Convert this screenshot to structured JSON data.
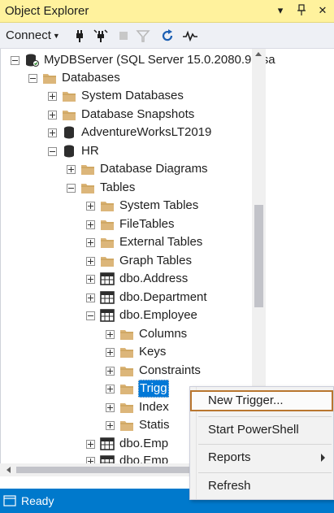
{
  "window": {
    "title": "Object Explorer",
    "buttons": [
      "▾",
      "🖈",
      "✕"
    ]
  },
  "toolbar": {
    "connect_label": "Connect",
    "icons": [
      "connect-plug-icon",
      "disconnect-plug-icon",
      "stop-icon",
      "filter-icon",
      "refresh-icon",
      "activity-monitor-icon"
    ]
  },
  "tree": {
    "server": "MyDBServer (SQL Server 15.0.2080.9 - sa",
    "databases": "Databases",
    "system_databases": "System Databases",
    "database_snapshots": "Database Snapshots",
    "adventureworks": "AdventureWorksLT2019",
    "hr": "HR",
    "database_diagrams": "Database Diagrams",
    "tables": "Tables",
    "system_tables": "System Tables",
    "filetables": "FileTables",
    "external_tables": "External Tables",
    "graph_tables": "Graph Tables",
    "dbo_address": "dbo.Address",
    "dbo_department": "dbo.Department",
    "dbo_employee": "dbo.Employee",
    "columns": "Columns",
    "keys": "Keys",
    "constraints": "Constraints",
    "triggers": "Trigg",
    "indexes": "Index",
    "statistics": "Statis",
    "dbo_emp1": "dbo.Emp",
    "dbo_emp2": "dbo.Emp"
  },
  "context_menu": {
    "new_trigger": "New Trigger...",
    "start_powershell": "Start PowerShell",
    "reports": "Reports",
    "refresh": "Refresh"
  },
  "status": {
    "text": "Ready"
  },
  "colors": {
    "title_bg": "#fff29d",
    "status_bg": "#0079cc",
    "selection": "#0078d7",
    "menu_highlight_border": "#b9762f"
  }
}
